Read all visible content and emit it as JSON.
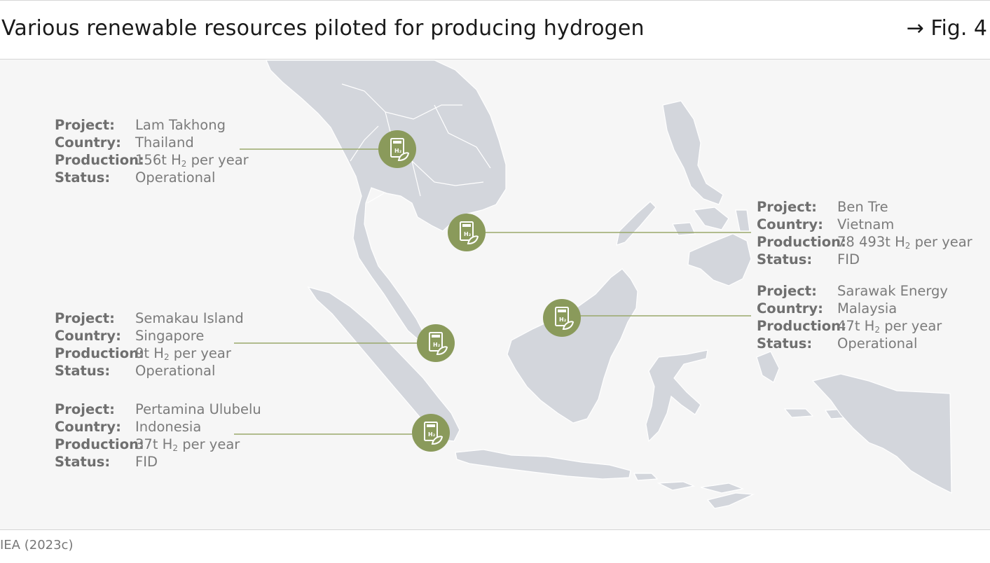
{
  "header": {
    "title": "Various renewable resources piloted for producing hydrogen",
    "figure_ref": "→ Fig. 4"
  },
  "map": {
    "land_color": "#d3d6dc",
    "background_color": "#f6f6f6",
    "marker_color": "#8a9a5b",
    "leader_color": "#9aa86b",
    "marker_icon": "hydrogen-leaf-icon",
    "marker_icon_label": "H2"
  },
  "labels": {
    "project": "Project:",
    "country": "Country:",
    "production": "Production:",
    "status": "Status:",
    "h2_symbol": "H",
    "h2_subscript": "2",
    "per_year": "per year"
  },
  "projects": [
    {
      "project": "Lam Takhong",
      "country": "Thailand",
      "amount": "156t",
      "status": "Operational"
    },
    {
      "project": "Ben Tre",
      "country": "Vietnam",
      "amount": "78 493t",
      "status": "FID"
    },
    {
      "project": "Sarawak Energy",
      "country": "Malaysia",
      "amount": "47t",
      "status": "Operational"
    },
    {
      "project": "Semakau Island",
      "country": "Singapore",
      "amount": "9t",
      "status": "Operational"
    },
    {
      "project": "Pertamina Ulubelu",
      "country": "Indonesia",
      "amount": "37t",
      "status": "FID"
    }
  ],
  "source": "IEA (2023c)"
}
